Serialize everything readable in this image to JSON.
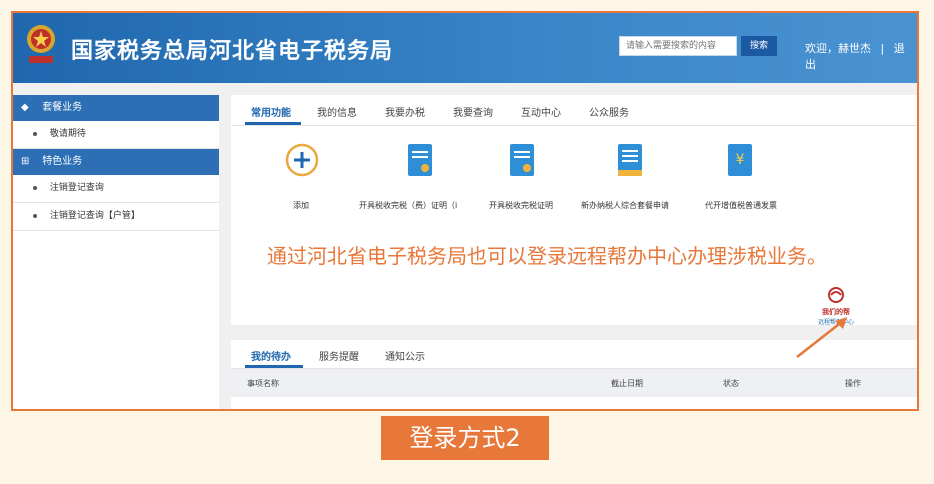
{
  "header": {
    "site_title": "国家税务总局河北省电子税务局",
    "search_placeholder": "请输入需要搜索的内容",
    "search_button": "搜索",
    "welcome": "欢迎，赫世杰",
    "separator": "|",
    "logout": "退出"
  },
  "sidebar": {
    "sections": [
      {
        "label": "套餐业务",
        "items": [
          "敬请期待"
        ]
      },
      {
        "label": "特色业务",
        "items": [
          "注销登记查询",
          "注销登记查询【户管】"
        ]
      }
    ]
  },
  "tabs": [
    "常用功能",
    "我的信息",
    "我要办税",
    "我要查询",
    "互动中心",
    "公众服务"
  ],
  "functions": [
    {
      "label": "添加",
      "icon": "add-icon"
    },
    {
      "label": "开具税收完税（费）证明（i",
      "icon": "document-icon"
    },
    {
      "label": "开具税收完税证明",
      "icon": "document-icon"
    },
    {
      "label": "新办纳税人综合套餐申请",
      "icon": "form-icon"
    },
    {
      "label": "代开增值税普通发票",
      "icon": "invoice-icon"
    }
  ],
  "announcement": "通过河北省电子税务局也可以登录远程帮办中心办理涉税业务。",
  "remote_center": {
    "line1": "我们的帮",
    "line2": "远程帮办中心"
  },
  "todo_tabs": [
    "我的待办",
    "服务提醒",
    "通知公示"
  ],
  "table_headers": [
    "事项名称",
    "截止日期",
    "状态",
    "操作"
  ],
  "caption": "登录方式2",
  "colors": {
    "header_blue": "#1f67ae",
    "accent_orange": "#e8773a",
    "background": "#fdf6e6"
  }
}
